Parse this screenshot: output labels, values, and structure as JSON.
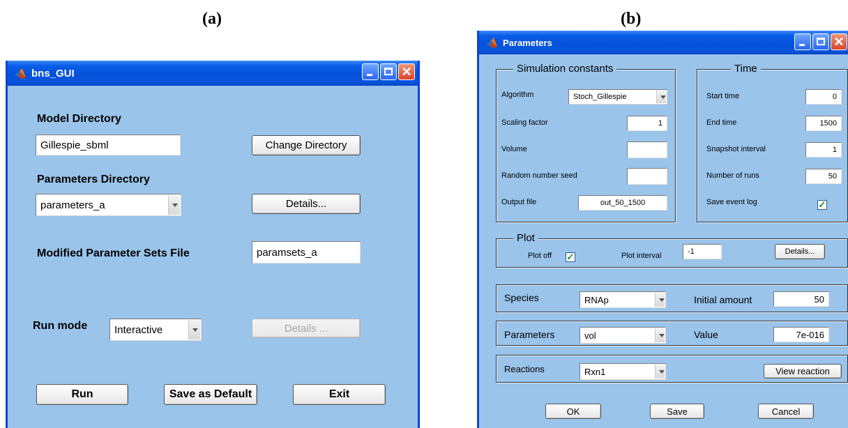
{
  "figure_labels": {
    "a": "(a)",
    "b": "(b)"
  },
  "bns_gui": {
    "title": "bns_GUI",
    "model_directory_label": "Model Directory",
    "model_directory_value": "Gillespie_sbml",
    "change_directory_button": "Change Directory",
    "parameters_directory_label": "Parameters Directory",
    "parameters_directory_selected": "parameters_a",
    "details_button": "Details...",
    "modified_parameter_sets_label": "Modified Parameter Sets File",
    "modified_parameter_sets_value": "paramsets_a",
    "run_mode_label": "Run mode",
    "run_mode_selected": "Interactive",
    "details_disabled_button": "Details ...",
    "run_button": "Run",
    "save_default_button": "Save as Default",
    "exit_button": "Exit"
  },
  "parameters_window": {
    "title": "Parameters",
    "simulation_constants": {
      "title": "Simulation constants",
      "algorithm_label": "Algorithm",
      "algorithm_selected": "Stoch_Gillespie",
      "scaling_factor_label": "Scaling factor",
      "scaling_factor_value": "1",
      "volume_label": "Volume",
      "volume_value": "",
      "random_seed_label": "Random number seed",
      "random_seed_value": "",
      "output_file_label": "Output file",
      "output_file_value": "out_50_1500"
    },
    "time": {
      "title": "Time",
      "start_time_label": "Start time",
      "start_time_value": "0",
      "end_time_label": "End time",
      "end_time_value": "1500",
      "snapshot_interval_label": "Snapshot interval",
      "snapshot_interval_value": "1",
      "number_of_runs_label": "Number of runs",
      "number_of_runs_value": "50",
      "save_event_log_label": "Save event log",
      "save_event_log_checked": true
    },
    "plot": {
      "title": "Plot",
      "plot_off_label": "Plot off",
      "plot_off_checked": true,
      "plot_interval_label": "Plot interval",
      "plot_interval_value": "-1",
      "details_button": "Details..."
    },
    "species": {
      "label": "Species",
      "selected": "RNAp",
      "amount_label": "Initial amount",
      "amount_value": "50"
    },
    "parameters": {
      "label": "Parameters",
      "selected": "vol",
      "value_label": "Value",
      "value": "7e-016"
    },
    "reactions": {
      "label": "Reactions",
      "selected": "Rxn1",
      "view_button": "View reaction"
    },
    "ok_button": "OK",
    "save_button": "Save",
    "cancel_button": "Cancel",
    "check_glyph": "✓"
  },
  "colors": {
    "window_bg": "#9ac4ea",
    "titlebar": "#0651d9",
    "frame": "#0b46d8"
  }
}
